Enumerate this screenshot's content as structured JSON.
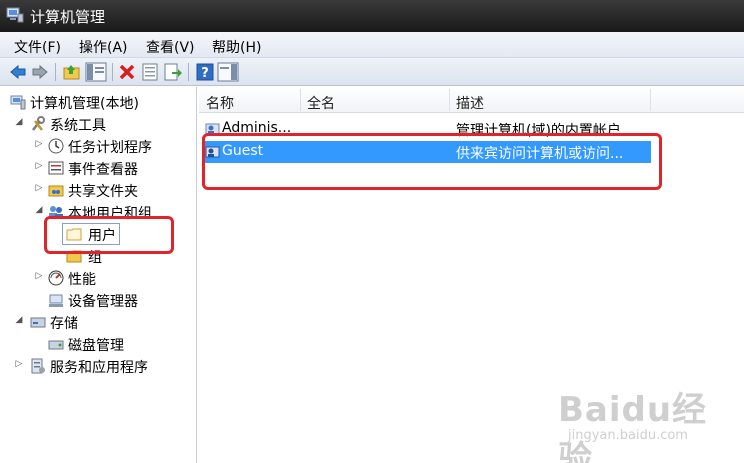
{
  "window": {
    "title": "计算机管理"
  },
  "menu": [
    "文件(F)",
    "操作(A)",
    "查看(V)",
    "帮助(H)"
  ],
  "toolbar": {
    "icons": [
      "back-icon",
      "forward-icon",
      "up-folder-icon",
      "show-hide-tree-icon",
      "delete-icon",
      "properties-icon",
      "export-icon",
      "help-icon",
      "show-action-pane-icon"
    ]
  },
  "tree": {
    "root": "计算机管理(本地)",
    "system_tools": "系统工具",
    "task_scheduler": "任务计划程序",
    "event_viewer": "事件查看器",
    "shared_folders": "共享文件夹",
    "local_users_groups": "本地用户和组",
    "users": "用户",
    "groups": "组",
    "performance": "性能",
    "device_manager": "设备管理器",
    "storage": "存储",
    "disk_management": "磁盘管理",
    "services_apps": "服务和应用程序"
  },
  "list": {
    "columns": [
      "名称",
      "全名",
      "描述"
    ],
    "rows": [
      {
        "name": "Adminis...",
        "fullname": "",
        "description": "管理计算机(域)的内置帐户"
      },
      {
        "name": "Guest",
        "fullname": "",
        "description": "供来宾访问计算机或访问..."
      }
    ]
  },
  "watermark": {
    "brand": "Baidu经验",
    "url": "jingyan.baidu.com"
  },
  "colors": {
    "selection": "#3399ff",
    "annotation": "#e0242b"
  }
}
